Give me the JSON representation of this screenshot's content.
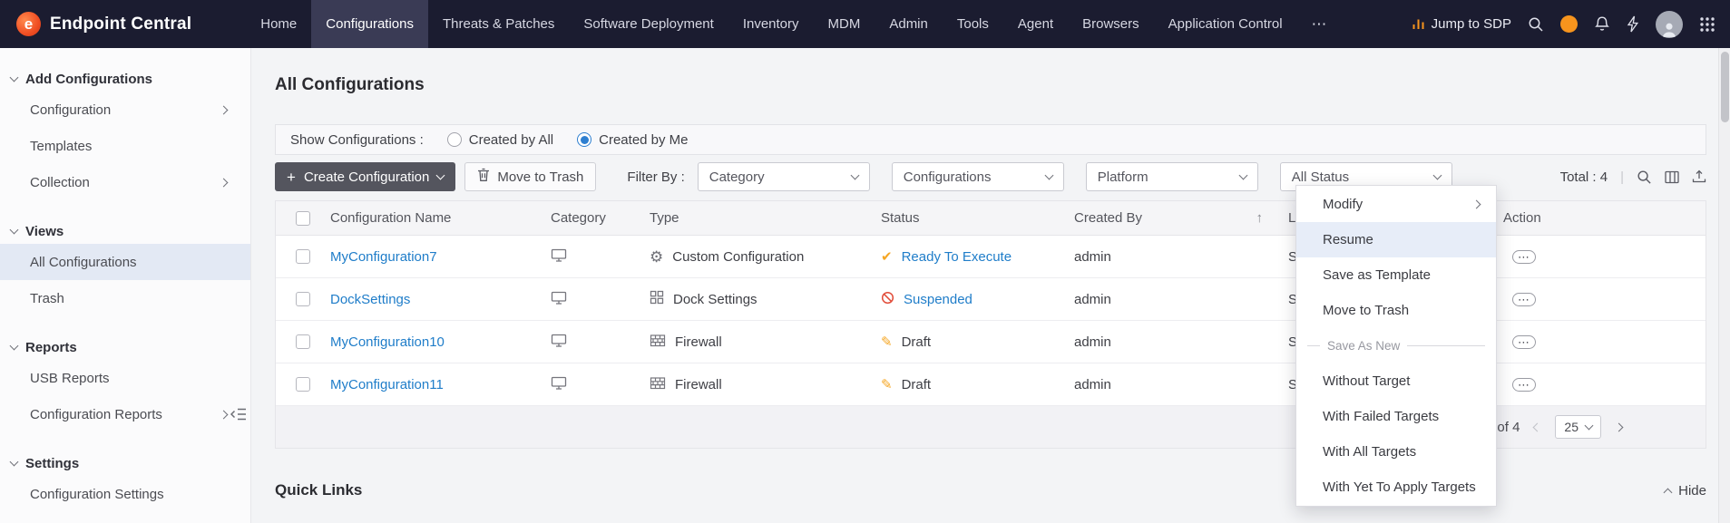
{
  "topbar": {
    "brand": "Endpoint Central",
    "nav": [
      "Home",
      "Configurations",
      "Threats & Patches",
      "Software Deployment",
      "Inventory",
      "MDM",
      "Admin",
      "Tools",
      "Agent",
      "Browsers",
      "Application Control"
    ],
    "jump_to_sdp_label": "Jump to SDP"
  },
  "sidebar": {
    "sections": [
      {
        "title": "Add Configurations",
        "items": [
          "Configuration",
          "Templates",
          "Collection"
        ]
      },
      {
        "title": "Views",
        "items": [
          "All Configurations",
          "Trash"
        ]
      },
      {
        "title": "Reports",
        "items": [
          "USB Reports",
          "Configuration Reports"
        ]
      },
      {
        "title": "Settings",
        "items": [
          "Configuration Settings"
        ]
      }
    ]
  },
  "main": {
    "title": "All Configurations",
    "filter_bar": {
      "label": "Show Configurations :",
      "options": [
        {
          "label": "Created by All",
          "selected": false
        },
        {
          "label": "Created by Me",
          "selected": true
        }
      ]
    },
    "toolbar": {
      "create_label": "Create Configuration",
      "trash_label": "Move to Trash",
      "filter_by_label": "Filter By :",
      "filters": [
        "Category",
        "Configurations",
        "Platform",
        "All Status"
      ],
      "total_label": "Total : 4"
    },
    "table": {
      "headers": {
        "name": "Configuration Name",
        "category": "Category",
        "type": "Type",
        "status": "Status",
        "created_by": "Created By",
        "truncated_col": "L",
        "action": "Action"
      },
      "rows": [
        {
          "name": "MyConfiguration7",
          "type": "Custom Configuration",
          "status": "Ready To Execute",
          "created_by": "admin",
          "extra": "S"
        },
        {
          "name": "DockSettings",
          "type": "Dock Settings",
          "status": "Suspended",
          "created_by": "admin",
          "extra": "S"
        },
        {
          "name": "MyConfiguration10",
          "type": "Firewall",
          "status": "Draft",
          "created_by": "admin",
          "extra": "S"
        },
        {
          "name": "MyConfiguration11",
          "type": "Firewall",
          "status": "Draft",
          "created_by": "admin",
          "extra": "S"
        }
      ]
    },
    "pagination": {
      "range": "4 of 4",
      "page_size": "25"
    },
    "quick_links_title": "Quick Links",
    "hide_label": "Hide"
  },
  "context_menu": {
    "items": [
      "Modify",
      "Resume",
      "Save as Template",
      "Move to Trash"
    ],
    "divider_label": "Save As New",
    "sub_items": [
      "Without Target",
      "With Failed Targets",
      "With All Targets",
      "With Yet To Apply Targets"
    ]
  },
  "glyphs": {
    "more": "⋯",
    "gear": "⚙",
    "check": "✔",
    "pencil": "✎",
    "ellipsis": "⋯",
    "sort_asc": "↑",
    "plus": "+"
  },
  "colors": {
    "topbar_bg": "#1b1c30",
    "accent_blue": "#1f7dc9",
    "selected_radio": "#2e7fd0",
    "status_ready": "#f5a623",
    "status_suspended": "#e14b38",
    "status_draft": "#f5a623",
    "logo_orange": "#f04e23",
    "menu_highlight": "#e7edf8"
  }
}
